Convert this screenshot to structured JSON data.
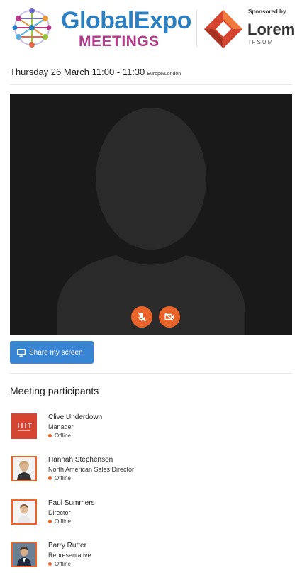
{
  "header": {
    "brand_main": "GlobalExpo",
    "brand_sub": "MEETINGS",
    "sponsor_label": "Sponsored by",
    "sponsor_name": "Lorem",
    "sponsor_sub": "IPSUM"
  },
  "event": {
    "datetime": "Thursday 26 March 11:00 - 11:30",
    "timezone": "Europe/London"
  },
  "video": {
    "mic_icon": "microphone-muted-icon",
    "cam_icon": "camera-off-icon"
  },
  "share_button": {
    "label": "Share my screen",
    "icon": "monitor-icon"
  },
  "participants_section": {
    "title": "Meeting participants",
    "items": [
      {
        "name": "Clive Underdown",
        "role": "Manager",
        "status": "Offline",
        "avatar": "company-logo"
      },
      {
        "name": "Hannah Stephenson",
        "role": "North American Sales Director",
        "status": "Offline",
        "avatar": "photo"
      },
      {
        "name": "Paul Summers",
        "role": "Director",
        "status": "Offline",
        "avatar": "photo"
      },
      {
        "name": "Barry Rutter",
        "role": "Representative",
        "status": "Offline",
        "avatar": "photo"
      }
    ]
  },
  "colors": {
    "brand_blue": "#2c7fc1",
    "brand_magenta": "#b53a8a",
    "accent_orange": "#e8642b",
    "button_blue": "#3a84d4"
  }
}
